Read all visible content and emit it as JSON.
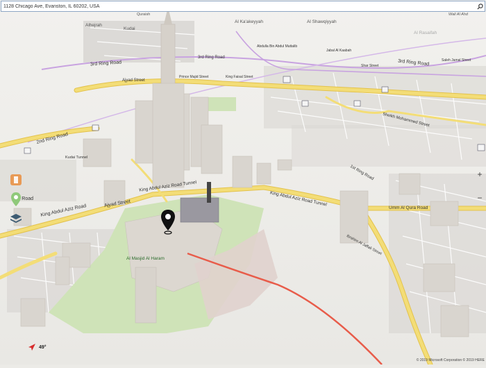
{
  "search": {
    "value": "1128 Chicago Ave, Evanston, IL 60202, USA"
  },
  "labels": {
    "alhejrah": "Alhejrah",
    "kudai": "Kudai",
    "bathaa": "Bathaa\nQuraish",
    "alkakeyyah": "Al Ka'akeyyah",
    "alshawqiyyah": "Al Shawqiyyah",
    "walialahd": "Wali Al Ahd",
    "alrasaifah": "Al Rasaifah",
    "alaziziyah": "Al Aziziyah"
  },
  "roads": {
    "ring3_left": "3rd Ring Road",
    "ring3_right": "3rd Ring Road",
    "ring3_mid": "3rd Ring Road",
    "ring2": "2nd Ring Road",
    "ring1": "1st Ring Road",
    "ajyad_top": "Ajyad Street",
    "ajyad_left": "Ajyad Street",
    "kingabdulaziz_left": "King Abdul Aziz Road",
    "kingabdulaziz_tunnel": "King Abdul Aziz Road Tunnel",
    "kingabdulaziz_tunnel2": "King Abdul Aziz Road Tunnel",
    "kingfahd": "King Fahd Road",
    "ummalqura": "Umm Al Qura Road",
    "ibrahim": "Ibrahim Al Jaffali Street",
    "prince_majid": "Prince Majid Street",
    "king_faisal": "King Faisal Street",
    "kaaba_st": "Abdulla Bin Abdul Muttalib",
    "jabal": "Jabal Al Kaabah",
    "shaar": "Shar Street",
    "sheikh": "Sheikh Mohammed Street",
    "ring_road_left": "ing Road",
    "ajyad_tunnel": "Kudai Tunnel",
    "saleh": "Saleh Jamal Street"
  },
  "poi": {
    "masjid": "Al Masjid Al Haram"
  },
  "heading": {
    "value": "49°"
  },
  "copyright": "© 2019 Microsoft Corporation  © 2019 HERE",
  "colors": {
    "road_yellow": "#f3dd77",
    "road_outline": "#e3c24c",
    "ring_purple": "#c8a3e0",
    "route_red": "#e85c4a",
    "green": "#cfe3b8"
  },
  "icons": {
    "pin": "location-pin-icon",
    "search": "search-icon"
  }
}
